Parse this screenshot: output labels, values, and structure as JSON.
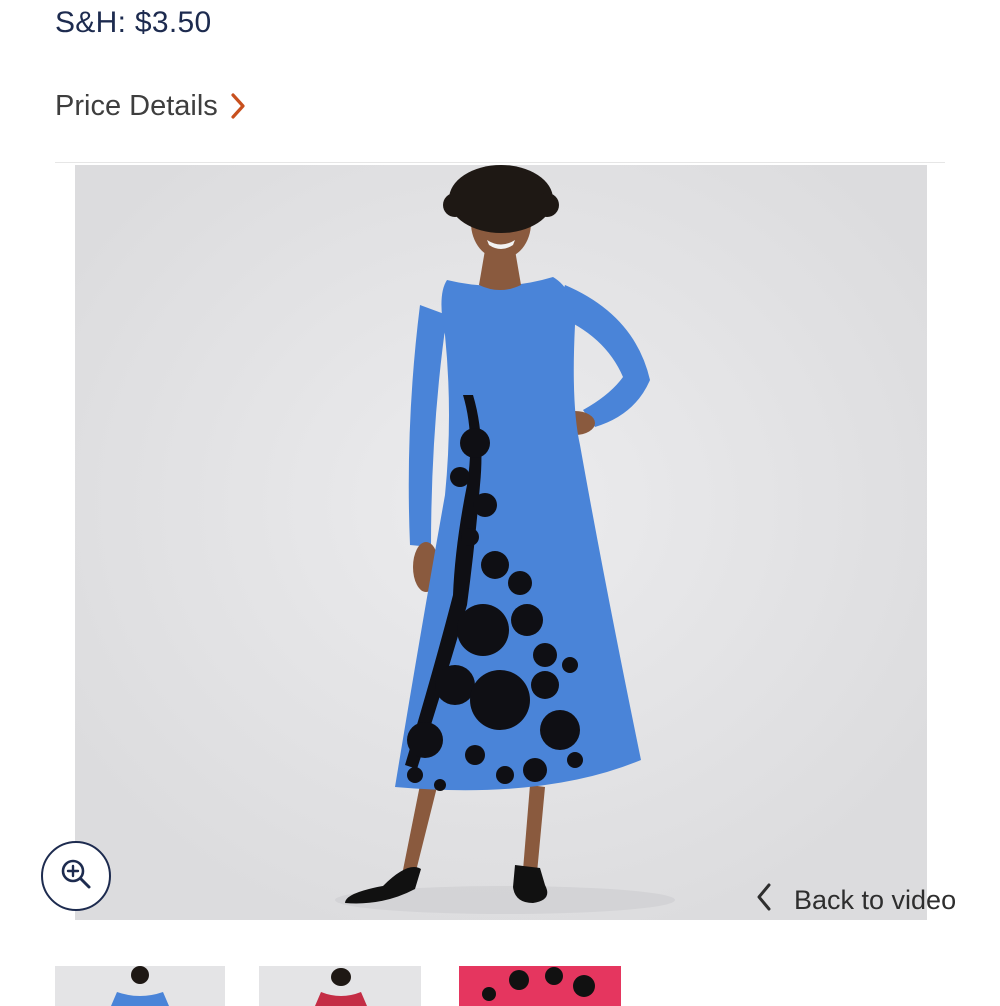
{
  "shipping": {
    "label": "S&H: $3.50"
  },
  "price_details": {
    "label": "Price Details",
    "icon": "chevron-right-icon",
    "accent_color": "#c8501e"
  },
  "hero": {
    "zoom_icon": "zoom-in-icon"
  },
  "back_to_video": {
    "label": "Back to video",
    "icon": "chevron-left-icon"
  },
  "thumbnails": [
    {
      "name": "thumb-blue-dress",
      "dress_color": "#4a84d8",
      "selected": true
    },
    {
      "name": "thumb-red-dress",
      "dress_color": "#c42d45",
      "selected": false
    },
    {
      "name": "thumb-pink-floral-dress",
      "dress_color": "#e5365f",
      "selected": false
    }
  ],
  "colors": {
    "text_primary": "#1d2b4f",
    "dress_blue": "#4a84d8",
    "floral_black": "#0f0f14"
  }
}
